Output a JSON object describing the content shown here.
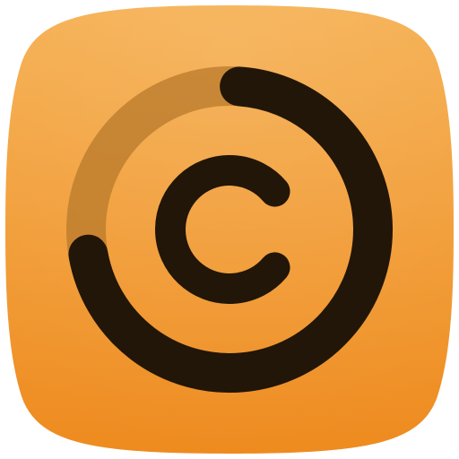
{
  "icon": {
    "name": "app-icon-orange-ring-c",
    "colors": {
      "gradient_top": "#F5AE4E",
      "gradient_bottom": "#EE8B1F",
      "ring_dark": "#211608",
      "ring_track": "#B87A2B",
      "ring_track_opacity": "0.75"
    },
    "ring_progress_fraction": 0.75
  }
}
